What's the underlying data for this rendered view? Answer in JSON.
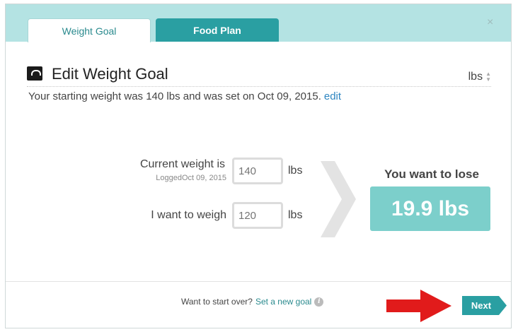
{
  "tabs": [
    {
      "label": "Weight Goal",
      "active": true
    },
    {
      "label": "Food Plan",
      "active": false
    }
  ],
  "close_glyph": "×",
  "edit": {
    "title": "Edit Weight Goal",
    "unit_selected": "lbs",
    "starting_text": "Your starting weight was 140 lbs and was set on Oct 09, 2015.",
    "edit_link": "edit"
  },
  "current": {
    "label": "Current weight is",
    "logged": "LoggedOct 09, 2015",
    "placeholder": "140",
    "unit": "lbs"
  },
  "target": {
    "label": "I want to weigh",
    "placeholder": "120",
    "unit": "lbs"
  },
  "result": {
    "label": "You want to lose",
    "value": "19.9 lbs"
  },
  "footer": {
    "prompt": "Want to start over?",
    "link": "Set a new goal",
    "next_label": "Next"
  },
  "colors": {
    "header_bg": "#b4e3e3",
    "tab_inactive": "#2a9fa2",
    "result_bg": "#7ccfcb",
    "next_button": "#2a9fa2",
    "arrow": "#e11b1b"
  }
}
